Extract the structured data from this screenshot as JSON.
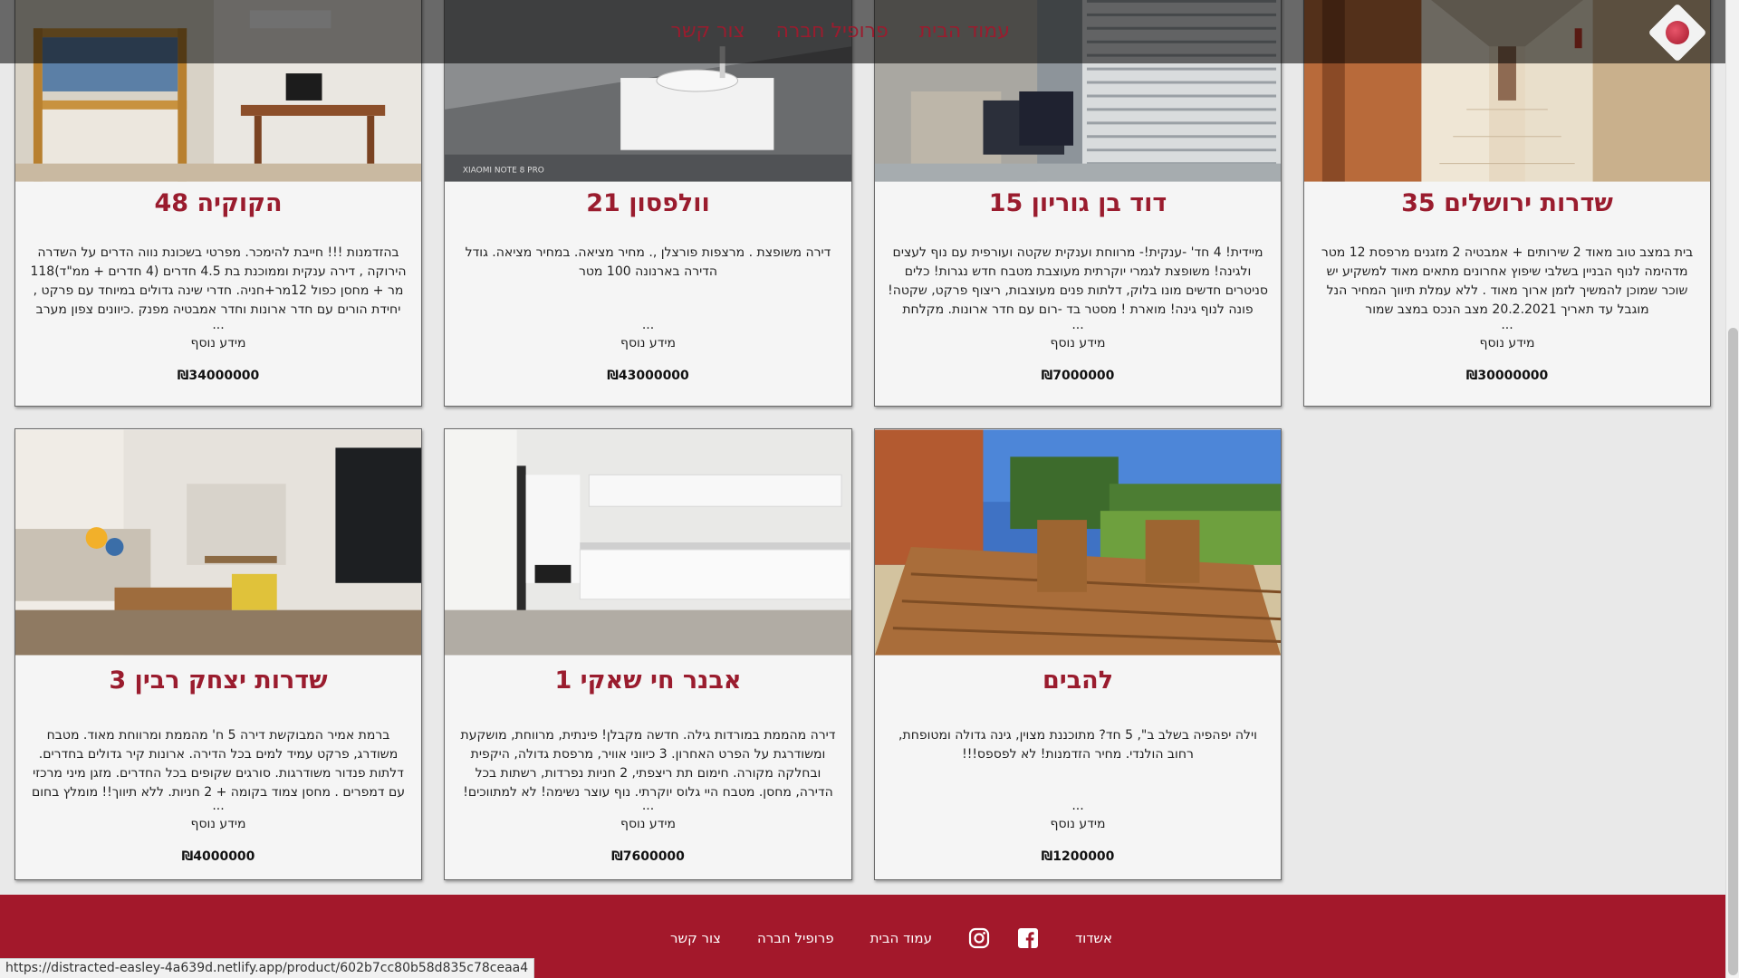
{
  "nav": {
    "links": [
      "עמוד הבית",
      "פרופיל חברה",
      "צור קשר"
    ]
  },
  "cards": [
    {
      "title": "שדרות ירושלים 35",
      "desc": "בית במצב טוב מאוד 2 שירותים + אמבטיה 2 מזגנים מרפסת 12 מטר מדהימה לנוף הבניין בשלבי שיפוץ אחרונים מתאים מאוד למשקיע יש שוכר שמוכן להמשיך לזמן ארוך מאוד . ללא עמלת תיווך המחיר הנל מוגבל עד תאריך 20.2.2021 מצב הנכס במצב שמור",
      "more": "מידע נוסף",
      "price": "₪30000000"
    },
    {
      "title": "דוד בן גוריון 15",
      "desc": "מיידית! 4 חד' -ענקית!- מרווחת וענקית שקטה ועורפית עם נוף לעצים ולגינה! משופצת לגמרי יוקרתית מעוצבת מטבח חדש נגרות! כלים סניטרים חדשים מונו בלוק, דלתות פנים מעוצבות, ריצוף פרקט, שקטה! פונה לנוף גינה! מוארת ! מסטר בד -רום עם חדר ארונות. מקלחת ושירותים. מיזוג בכל",
      "more": "מידע נוסף",
      "price": "₪7000000"
    },
    {
      "title": "וולפסון 21",
      "desc": "דירה משופצת . מרצפות פורצלן ,. מחיר מציאה. במחיר מציאה. גודל הדירה בארנונה 100 מטר",
      "more": "מידע נוסף",
      "price": "₪43000000"
    },
    {
      "title": "הקוקיה 48",
      "desc": "בהזדמנות !!! חייבת להימכר. מפרטי בשכונת נווה הדרים על השדרה הירוקה , דירה ענקית וממוכנת בת 4.5 חדרים (4 חדרים + ממ\"ד)118 מר + מחסן כפול 12מר+חניה. חדרי שינה גדולים במיוחד עם פרקט , יחידת הורים עם חדר ארונות וחדר אמבטיה מפנק .כיוונים צפון מערב .מזגן מיני מרכזי +",
      "more": "מידע נוסף",
      "price": "₪34000000"
    },
    {
      "title": "להבים",
      "desc": "וילה יפהפיה בשלב ב\", 5 חד? מתוכננת מצוין, גינה גדולה ומטופחת, רחוב הולנדי. מחיר הזדמנות! לא לפספס!!!",
      "more": "מידע נוסף",
      "price": "₪1200000"
    },
    {
      "title": "אבנר חי שאקי 1",
      "desc": "דירה מהממת במורדות גילה. חדשה מקבלן! פינתית, מרווחת, מושקעת ומשודרגת על הפרט האחרון. 3 כיווני אוויר, מרפסת גדולה, היקפית ובחלקה מקורה. חימום תת ריצפתי, 2 חניות נפרדות, רשתות בכל הדירה, מחסן. מטבח היי גלוס יוקרתי. נוף עוצר נשימה! לא למתווכים!",
      "more": "מידע נוסף",
      "price": "₪7600000"
    },
    {
      "title": "שדרות יצחק רבין 3",
      "desc": "ברמת אמיר המבוקשת דירה 5 ח' מהממת ומרווחת מאוד. מטבח משודרג, פרקט עמיד למים בכל הדירה. ארונות קיר גדולים בחדרים. דלתות פנדור משודרגות. סורגים שקופים בכל החדרים. מזגן מיני מרכזי עם דמפרים . מחסן צמוד בקומה + 2 חניות. ללא תיווך!! מומלץ בחום לבוא להתרשם!",
      "more": "מידע נוסף",
      "price": "₪4000000"
    }
  ],
  "ellipsis": "...",
  "footer": {
    "city": "אשדוד",
    "home": "עמוד הבית",
    "profile": "פרופיל חברה",
    "contact": "צור קשר"
  },
  "status_url": "https://distracted-easley-4a639d.netlify.app/product/602b7cc80b58d835c78ceaa4",
  "colors": {
    "brand": "#a3182b",
    "title": "#9a1c2e",
    "card_bg": "#f5f5f5"
  }
}
